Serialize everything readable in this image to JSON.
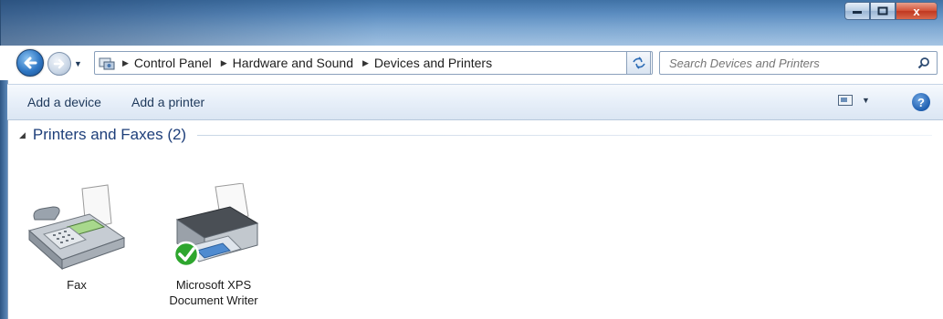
{
  "window": {
    "title_buttons": {
      "minimize": "minimize-icon",
      "maximize": "maximize-icon",
      "close": "x"
    }
  },
  "nav": {
    "breadcrumbs": [
      "Control Panel",
      "Hardware and Sound",
      "Devices and Printers"
    ],
    "search_placeholder": "Search Devices and Printers"
  },
  "commands": {
    "add_device": "Add a device",
    "add_printer": "Add a printer",
    "help": "?"
  },
  "group": {
    "title": "Printers and Faxes (2)",
    "devices": [
      {
        "name": "Fax",
        "icon": "fax-icon"
      },
      {
        "name": "Microsoft XPS",
        "name_line2": "Document Writer",
        "icon": "printer-icon",
        "default": true
      }
    ]
  },
  "colors": {
    "link_text": "#1e395b",
    "group_title": "#1e3f7a",
    "default_check": "#2ea62e"
  }
}
